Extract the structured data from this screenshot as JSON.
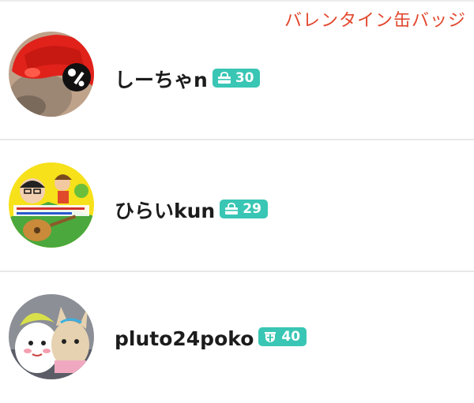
{
  "caption": "バレンタイン缶バッジ",
  "users": [
    {
      "name": "しーちゃn",
      "count": "30",
      "badge_icon": "bag-icon",
      "avatar": "red-hat-cat-avatar"
    },
    {
      "name": "ひらいkun",
      "count": "29",
      "badge_icon": "bag-icon",
      "avatar": "anime-creator-avatar"
    },
    {
      "name": "pluto24poko",
      "count": "40",
      "badge_icon": "crest-icon",
      "avatar": "plush-toys-avatar"
    }
  ],
  "colors": {
    "badge": "#39c6b4",
    "caption": "#e2482f",
    "text": "#1c1c1c"
  }
}
